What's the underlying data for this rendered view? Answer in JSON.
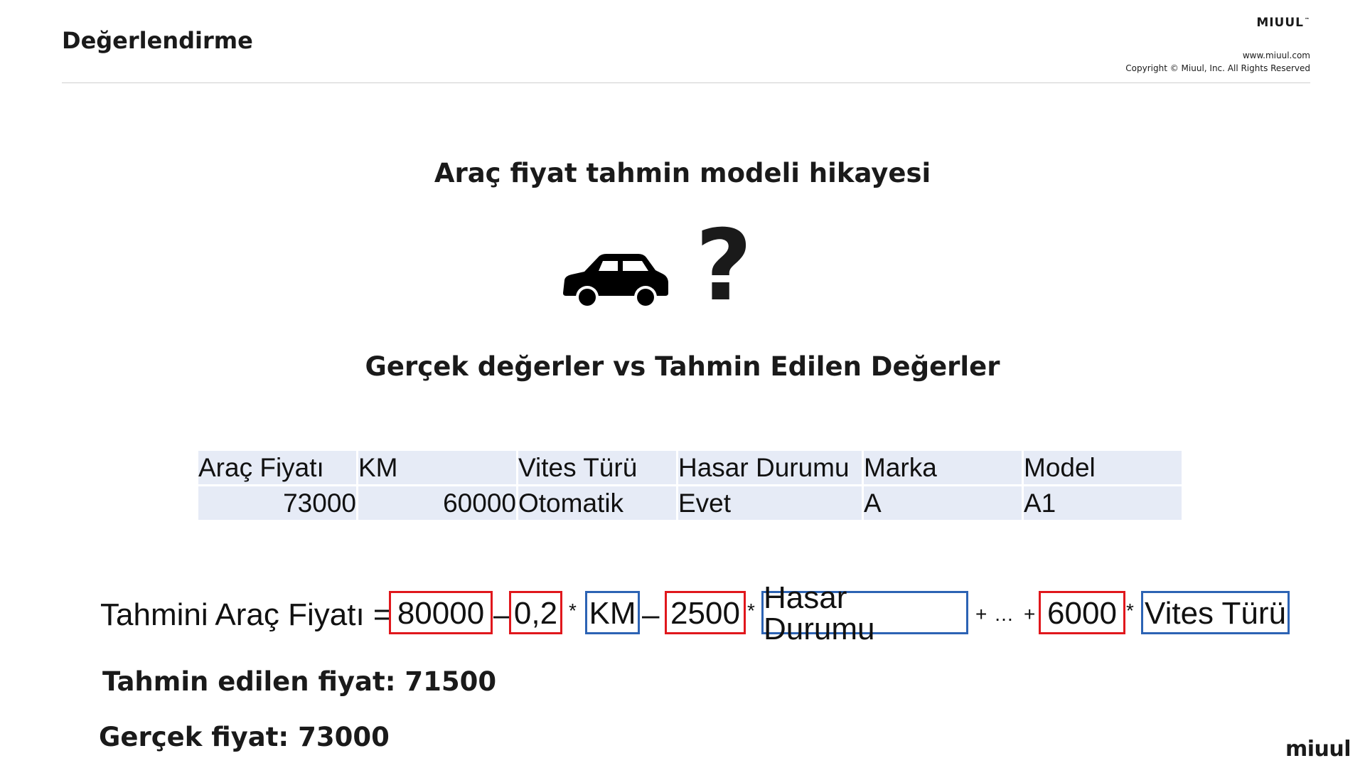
{
  "header": {
    "slide_title": "Değerlendirme",
    "brand": "MIUUL",
    "trademark": "™",
    "website": "www.miuul.com",
    "copyright": "Copyright © Miuul, Inc. All Rights Reserved"
  },
  "story_title": "Araç fiyat tahmin modeli hikayesi",
  "icons": {
    "car": "car-icon",
    "question": "question-mark-icon"
  },
  "question_glyph": "?",
  "compare_title": "Gerçek değerler vs Tahmin Edilen Değerler",
  "table": {
    "headers": [
      "Araç Fiyatı",
      "KM",
      "Vites Türü",
      "Hasar Durumu",
      "Marka",
      "Model"
    ],
    "rows": [
      [
        "73000",
        "60000",
        "Otomatik",
        "Evet",
        "A",
        "A1"
      ]
    ]
  },
  "formula": {
    "lhs": "Tahmini Araç Fiyatı =",
    "intercept": "80000",
    "minus1": "–",
    "coef_km": "0,2",
    "mult1": "*",
    "var_km": "KM",
    "minus2": "–",
    "coef_hasar": "2500",
    "mult2": "*",
    "var_hasar": "Hasar Durumu",
    "plus1": "+",
    "ellipsis": "…",
    "plus2": "+",
    "coef_vites": "6000",
    "mult3": "*",
    "var_vites": "Vites Türü"
  },
  "predicted_text": "Tahmin edilen fiyat: 71500",
  "actual_text": "Gerçek fiyat: 73000",
  "footer_logo": "miuul",
  "colors": {
    "coefficient_box": "#e0171c",
    "variable_box": "#2c63b4",
    "table_fill": "#e6ebf6"
  }
}
